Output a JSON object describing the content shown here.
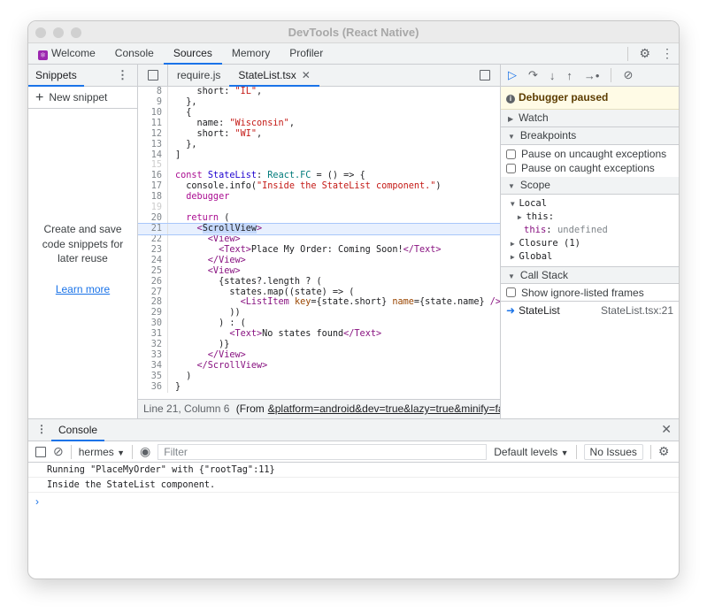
{
  "window": {
    "title": "DevTools (React Native)"
  },
  "tabs": [
    {
      "label": "Welcome"
    },
    {
      "label": "Console"
    },
    {
      "label": "Sources",
      "active": true
    },
    {
      "label": "Memory"
    },
    {
      "label": "Profiler"
    }
  ],
  "navigator": {
    "tab": "Snippets",
    "new_snippet": "New snippet",
    "empty_text": "Create and save code snippets for later reuse",
    "learn_more": "Learn more"
  },
  "editor": {
    "files": [
      {
        "name": "require.js"
      },
      {
        "name": "StateList.tsx",
        "active": true
      }
    ],
    "highlight_line": 21,
    "lines": [
      {
        "n": "8",
        "t": [
          [
            "p",
            "    short: "
          ],
          [
            "str",
            "\"IL\""
          ],
          [
            "p",
            ","
          ]
        ]
      },
      {
        "n": "9",
        "t": [
          [
            "p",
            "  },"
          ]
        ]
      },
      {
        "n": "10",
        "t": [
          [
            "p",
            "  {"
          ]
        ]
      },
      {
        "n": "11",
        "t": [
          [
            "p",
            "    name: "
          ],
          [
            "str",
            "\"Wisconsin\""
          ],
          [
            "p",
            ","
          ]
        ]
      },
      {
        "n": "12",
        "t": [
          [
            "p",
            "    short: "
          ],
          [
            "str",
            "\"WI\""
          ],
          [
            "p",
            ","
          ]
        ]
      },
      {
        "n": "13",
        "t": [
          [
            "p",
            "  },"
          ]
        ]
      },
      {
        "n": "14",
        "t": [
          [
            "p",
            "]"
          ]
        ]
      },
      {
        "n": "15",
        "t": []
      },
      {
        "n": "16",
        "t": [
          [
            "kw",
            "const "
          ],
          [
            "def",
            "StateList"
          ],
          [
            "p",
            ": "
          ],
          [
            "type",
            "React.FC"
          ],
          [
            "p",
            " = () => {"
          ]
        ]
      },
      {
        "n": "17",
        "t": [
          [
            "p",
            "  console.info("
          ],
          [
            "str",
            "\"Inside the StateList component.\""
          ],
          [
            "p",
            ")"
          ]
        ]
      },
      {
        "n": "18",
        "t": [
          [
            "kw",
            "  debugger"
          ]
        ]
      },
      {
        "n": "19",
        "t": []
      },
      {
        "n": "20",
        "t": [
          [
            "kw",
            "  return"
          ],
          [
            "p",
            " ("
          ]
        ]
      },
      {
        "n": "21",
        "t": [
          [
            "p",
            "    "
          ],
          [
            "tag",
            "<"
          ],
          [
            "sel",
            "ScrollView"
          ],
          [
            "tag",
            ">"
          ]
        ]
      },
      {
        "n": "22",
        "t": [
          [
            "tag",
            "      <View>"
          ]
        ]
      },
      {
        "n": "23",
        "t": [
          [
            "tag",
            "        <Text>"
          ],
          [
            "p",
            "Place My Order: Coming Soon!"
          ],
          [
            "tag",
            "</Text>"
          ]
        ]
      },
      {
        "n": "24",
        "t": [
          [
            "tag",
            "      </View>"
          ]
        ]
      },
      {
        "n": "25",
        "t": [
          [
            "tag",
            "      <View>"
          ]
        ]
      },
      {
        "n": "26",
        "t": [
          [
            "p",
            "        {states?.length ? ("
          ]
        ]
      },
      {
        "n": "27",
        "t": [
          [
            "p",
            "          states.map((state) => ("
          ]
        ]
      },
      {
        "n": "28",
        "t": [
          [
            "tag",
            "            <ListItem "
          ],
          [
            "attr",
            "key"
          ],
          [
            "p",
            "={state.short} "
          ],
          [
            "attr",
            "name"
          ],
          [
            "p",
            "={state.name} "
          ],
          [
            "tag",
            "/>"
          ]
        ]
      },
      {
        "n": "29",
        "t": [
          [
            "p",
            "          ))"
          ]
        ]
      },
      {
        "n": "30",
        "t": [
          [
            "p",
            "        ) : ("
          ]
        ]
      },
      {
        "n": "31",
        "t": [
          [
            "tag",
            "          <Text>"
          ],
          [
            "p",
            "No states found"
          ],
          [
            "tag",
            "</Text>"
          ]
        ]
      },
      {
        "n": "32",
        "t": [
          [
            "p",
            "        )}"
          ]
        ]
      },
      {
        "n": "33",
        "t": [
          [
            "tag",
            "      </View>"
          ]
        ]
      },
      {
        "n": "34",
        "t": [
          [
            "tag",
            "    </ScrollView>"
          ]
        ]
      },
      {
        "n": "35",
        "t": [
          [
            "p",
            "  )"
          ]
        ]
      },
      {
        "n": "36",
        "t": [
          [
            "p",
            "}"
          ]
        ]
      }
    ],
    "status": "Line 21, Column 6",
    "status_from": "(From",
    "status_link": "&platform=android&dev=true&lazy=true&minify=false&ap"
  },
  "debugger": {
    "paused": "Debugger paused",
    "watch": "Watch",
    "breakpoints": "Breakpoints",
    "pause_uncaught": "Pause on uncaught exceptions",
    "pause_caught": "Pause on caught exceptions",
    "scope": "Scope",
    "local": "Local",
    "this1": "this:",
    "this2": "this",
    "this2_val": "undefined",
    "closure": "Closure (1)",
    "global": "Global",
    "call_stack": "Call Stack",
    "show_ignored": "Show ignore-listed frames",
    "frame_name": "StateList",
    "frame_loc": "StateList.tsx:21"
  },
  "console": {
    "tab": "Console",
    "context": "hermes",
    "filter_placeholder": "Filter",
    "levels": "Default levels",
    "issues": "No Issues",
    "messages": [
      "Running \"PlaceMyOrder\" with {\"rootTag\":11}",
      "Inside the StateList component."
    ],
    "prompt": "›"
  },
  "colors": {
    "accent": "#1a73e8",
    "paused_bg": "#fffbe6"
  }
}
